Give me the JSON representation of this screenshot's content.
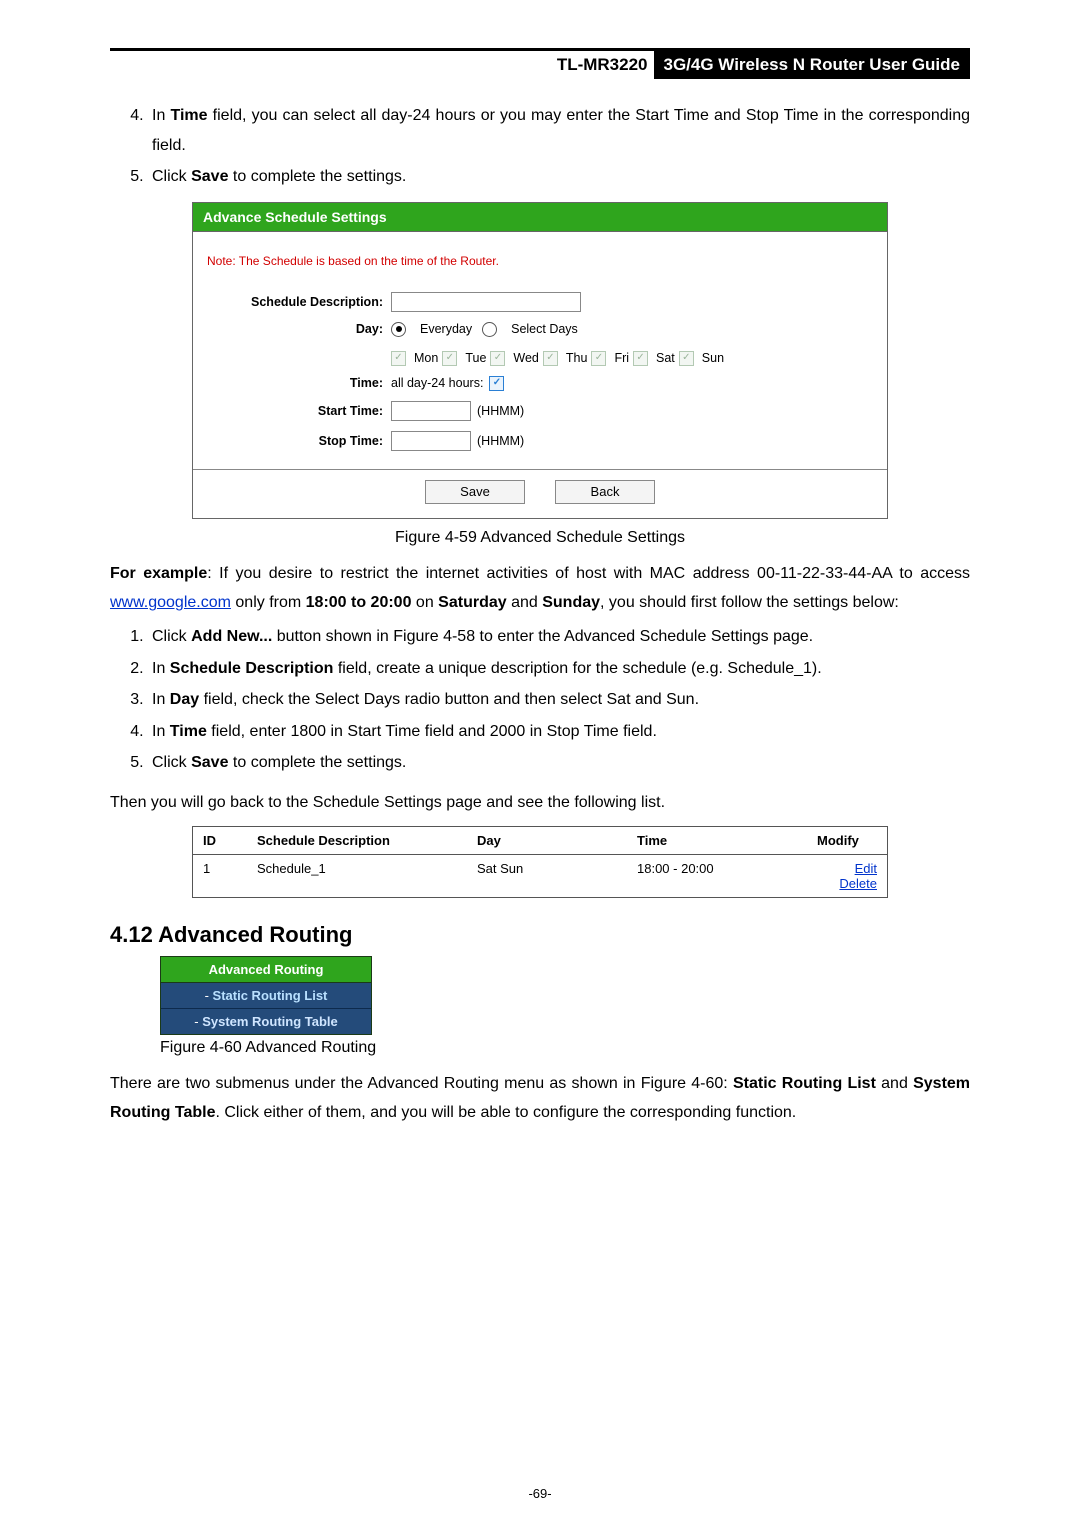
{
  "header": {
    "model": "TL-MR3220",
    "title": "3G/4G Wireless N Router User Guide"
  },
  "intro_steps": {
    "s4_a": "In ",
    "s4_b": "Time",
    "s4_c": " field, you can select all day-24 hours or you may enter the Start Time and Stop Time in the corresponding field.",
    "s5_a": "Click ",
    "s5_b": "Save",
    "s5_c": " to complete the settings."
  },
  "panel": {
    "title": "Advance Schedule Settings",
    "note": "Note: The Schedule is based on the time of the Router.",
    "labels": {
      "desc": "Schedule Description:",
      "day": "Day:",
      "time": "Time:",
      "start": "Start Time:",
      "stop": "Stop Time:"
    },
    "day_radio": {
      "everyday": "Everyday",
      "select": "Select Days"
    },
    "days": {
      "mon": "Mon",
      "tue": "Tue",
      "wed": "Wed",
      "thu": "Thu",
      "fri": "Fri",
      "sat": "Sat",
      "sun": "Sun"
    },
    "allday": "all day-24 hours:",
    "hhmm": "(HHMM)",
    "buttons": {
      "save": "Save",
      "back": "Back"
    }
  },
  "fig59": "Figure 4-59   Advanced Schedule Settings",
  "example": {
    "p1_a": "For example",
    "p1_b": ": If you desire to restrict the internet activities of host with MAC address 00-11-22-33-44-AA to access ",
    "p1_link": "www.google.com",
    "p1_c": " only from ",
    "p1_d": "18:00 to 20:00",
    "p1_e": " on ",
    "p1_f": "Saturday",
    "p1_g": " and ",
    "p1_h": "Sunday",
    "p1_i": ", you should first follow the settings below:",
    "s1_a": "Click ",
    "s1_b": "Add New...",
    "s1_c": " button shown in Figure 4-58 to enter the Advanced Schedule Settings page.",
    "s2_a": "In ",
    "s2_b": "Schedule Description",
    "s2_c": " field, create a unique description for the schedule (e.g. Schedule_1).",
    "s3_a": "In ",
    "s3_b": "Day",
    "s3_c": " field, check the Select Days radio button and then select Sat and Sun.",
    "s4_a": "In ",
    "s4_b": "Time",
    "s4_c": " field, enter 1800 in Start Time field and 2000 in Stop Time field.",
    "s5_a": "Click ",
    "s5_b": "Save",
    "s5_c": " to complete the settings.",
    "then": "Then you will go back to the Schedule Settings page and see the following list."
  },
  "table": {
    "headers": {
      "id": "ID",
      "desc": "Schedule Description",
      "day": "Day",
      "time": "Time",
      "mod": "Modify"
    },
    "row": {
      "id": "1",
      "desc": "Schedule_1",
      "day": "Sat Sun",
      "time": "18:00 - 20:00",
      "edit": "Edit",
      "delete": "Delete"
    }
  },
  "section_heading": "4.12 Advanced Routing",
  "ar_menu": {
    "head": "Advanced Routing",
    "static_prefix": "- ",
    "static": "Static Routing List",
    "system_prefix": "- ",
    "system": "System Routing Table"
  },
  "fig60": "Figure 4-60 Advanced Routing",
  "ar_para_a": "There are two submenus under the Advanced Routing menu as shown in Figure 4-60: ",
  "ar_para_b": "Static Routing List",
  "ar_para_c": " and ",
  "ar_para_d": "System Routing Table",
  "ar_para_e": ". Click either of them, and you will be able to configure the corresponding function.",
  "page_number": "-69-",
  "glyphs": {
    "check": "✓",
    "dot": ""
  }
}
